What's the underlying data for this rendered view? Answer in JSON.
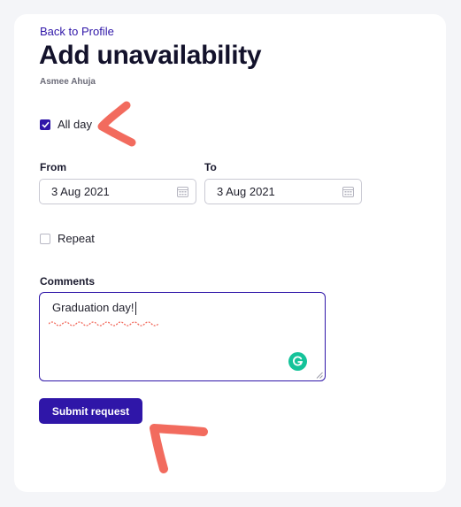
{
  "nav": {
    "back_label": "Back to Profile"
  },
  "header": {
    "title": "Add unavailability",
    "subtitle": "Asmee Ahuja"
  },
  "all_day": {
    "label": "All day",
    "checked": true
  },
  "from": {
    "label": "From",
    "value": "3 Aug 2021",
    "icon": "calendar-icon"
  },
  "to": {
    "label": "To",
    "value": "3 Aug 2021",
    "icon": "calendar-icon"
  },
  "repeat": {
    "label": "Repeat",
    "checked": false
  },
  "comments": {
    "label": "Comments",
    "value": "Graduation day!",
    "icon": "grammarly-icon"
  },
  "actions": {
    "submit_label": "Submit request"
  },
  "colors": {
    "accent": "#2f16a8",
    "annotation": "#f26b5e",
    "grammarly": "#15c39a"
  }
}
